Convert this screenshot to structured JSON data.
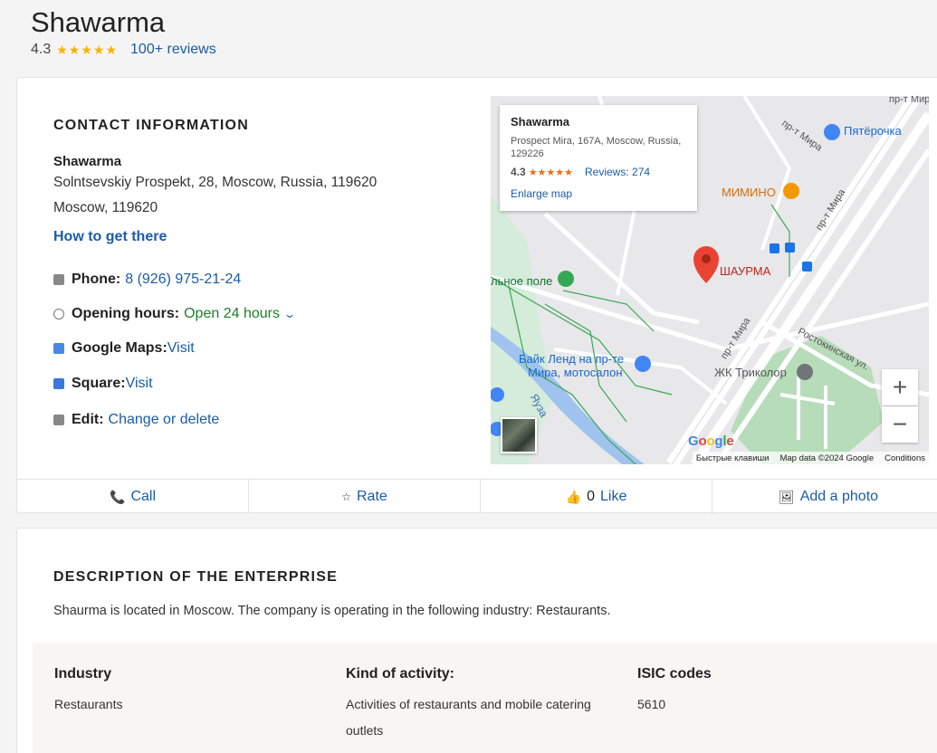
{
  "header": {
    "title": "Shawarma",
    "rating": "4.3",
    "stars": "★★★★★",
    "reviews": "100+ reviews"
  },
  "contact": {
    "heading": "CONTACT INFORMATION",
    "name": "Shawarma",
    "address_line1": "Solntsevskiy Prospekt, 28, Moscow, Russia, 119620",
    "address_line2": "Moscow, 119620",
    "directions": "How to get there",
    "phone_label": "Phone:",
    "phone": "8 (926) 975-21-24",
    "hours_label": "Opening hours:",
    "hours": "Open 24 hours",
    "gmaps_label": "Google Maps:",
    "gmaps_link": "Visit",
    "square_label": "Square:",
    "square_link": "Visit",
    "edit_label": "Edit:",
    "edit_link": "Change or delete"
  },
  "map": {
    "popup_name": "Shawarma",
    "popup_address": "Prospect Mira, 167A, Moscow, Russia, 129226",
    "popup_rating": "4.3",
    "popup_stars": "★★★★★",
    "popup_reviews": "Reviews: 274",
    "popup_enlarge": "Enlarge map",
    "labels": {
      "pyaterochka": "Пятёрочка",
      "mimino": "МИМИНО",
      "shaurma": "ШАУРМА",
      "pole": "льное поле",
      "bike1": "Байк Ленд на пр-те",
      "bike2": "Мира, мотосалон",
      "trikolor": "ЖК Триколор",
      "yauza": "Яуза",
      "mira1": "пр-т Мира",
      "mira2": "пр-т Мира",
      "mira3": "пр-т Мира",
      "rostok": "Ростокинская ул.",
      "mira_top": "пр-т Мира"
    },
    "google": "Google",
    "attrib_keys": "Быстрые клавиши",
    "attrib_data": "Map data ©2024 Google",
    "attrib_terms": "Conditions",
    "zoom_in": "+",
    "zoom_out": "−"
  },
  "actions": {
    "call": "Call",
    "rate": "Rate",
    "like_count": "0",
    "like": "Like",
    "photo": "Add a photo"
  },
  "description": {
    "heading": "DESCRIPTION OF THE ENTERPRISE",
    "text": "Shaurma is located in Moscow. The company is operating in the following industry: Restaurants.",
    "industry_h": "Industry",
    "industry_v": "Restaurants",
    "activity_h": "Kind of activity:",
    "activity_v1": "Activities of restaurants and mobile catering",
    "activity_v2": "outlets",
    "isic_h": "ISIC codes",
    "isic_v": "5610"
  },
  "colors": {
    "link": "#1a5ca8",
    "star": "#f5b400",
    "open": "#1b7f2a",
    "pin": "#d93025"
  }
}
